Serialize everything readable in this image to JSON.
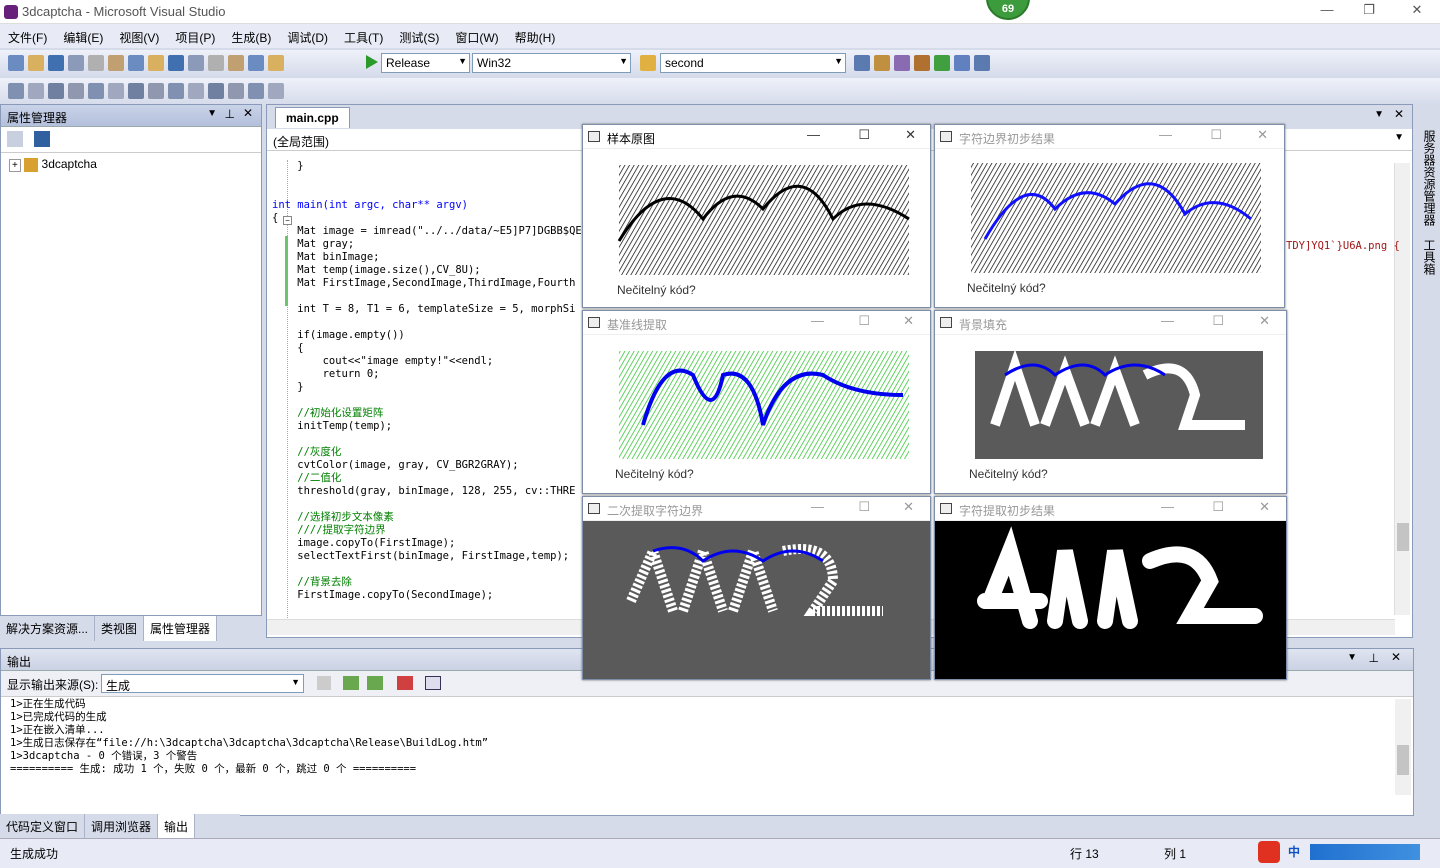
{
  "window": {
    "title": "3dcaptcha - Microsoft Visual Studio",
    "badge": "69"
  },
  "menu": [
    "文件(F)",
    "编辑(E)",
    "视图(V)",
    "项目(P)",
    "生成(B)",
    "调试(D)",
    "工具(T)",
    "测试(S)",
    "窗口(W)",
    "帮助(H)"
  ],
  "toolbar": {
    "config": "Release",
    "platform": "Win32",
    "find": "second"
  },
  "prop_manager": {
    "title": "属性管理器",
    "tree_item": "3dcaptcha"
  },
  "bottom_tabs": [
    "解决方案资源...",
    "类视图",
    "属性管理器"
  ],
  "editor": {
    "tab": "main.cpp",
    "scope": "(全局范围)",
    "right_fragment": "TDY]YQ1`}U6A.png {",
    "lines": [
      {
        "t": "    }",
        "c": ""
      },
      {
        "t": "",
        "c": ""
      },
      {
        "t": "",
        "c": ""
      },
      {
        "t": "int main(int argc, char** argv)",
        "c": "kw"
      },
      {
        "t": "{",
        "c": ""
      },
      {
        "t": "    Mat image = imread(\"../../data/~E5]P7]DGBB$QE",
        "c": ""
      },
      {
        "t": "    Mat gray;",
        "c": ""
      },
      {
        "t": "    Mat binImage;",
        "c": ""
      },
      {
        "t": "    Mat temp(image.size(),CV_8U);",
        "c": ""
      },
      {
        "t": "    Mat FirstImage,SecondImage,ThirdImage,Fourth",
        "c": ""
      },
      {
        "t": "",
        "c": ""
      },
      {
        "t": "    int T = 8, T1 = 6, templateSize = 5, morphSi",
        "c": ""
      },
      {
        "t": "",
        "c": ""
      },
      {
        "t": "    if(image.empty())",
        "c": ""
      },
      {
        "t": "    {",
        "c": ""
      },
      {
        "t": "        cout<<\"image empty!\"<<endl;",
        "c": ""
      },
      {
        "t": "        return 0;",
        "c": ""
      },
      {
        "t": "    }",
        "c": ""
      },
      {
        "t": "",
        "c": ""
      },
      {
        "t": "    //初始化设置矩阵",
        "c": "cm"
      },
      {
        "t": "    initTemp(temp);",
        "c": ""
      },
      {
        "t": "",
        "c": ""
      },
      {
        "t": "    //灰度化",
        "c": "cm"
      },
      {
        "t": "    cvtColor(image, gray, CV_BGR2GRAY);",
        "c": ""
      },
      {
        "t": "    //二值化",
        "c": "cm"
      },
      {
        "t": "    threshold(gray, binImage, 128, 255, cv::THRE",
        "c": ""
      },
      {
        "t": "",
        "c": ""
      },
      {
        "t": "    //选择初步文本像素",
        "c": "cm"
      },
      {
        "t": "    ////提取字符边界",
        "c": "cm"
      },
      {
        "t": "    image.copyTo(FirstImage);",
        "c": ""
      },
      {
        "t": "    selectTextFirst(binImage, FirstImage,temp);",
        "c": ""
      },
      {
        "t": "",
        "c": ""
      },
      {
        "t": "    //背景去除",
        "c": "cm"
      },
      {
        "t": "    FirstImage.copyTo(SecondImage);",
        "c": ""
      }
    ]
  },
  "cv_windows": [
    {
      "title": "样本原图",
      "caption": "Nečitelný kód?"
    },
    {
      "title": "字符边界初步结果",
      "caption": "Nečitelný kód?"
    },
    {
      "title": "基准线提取",
      "caption": "Nečitelný kód?"
    },
    {
      "title": "背景填充",
      "caption": "Nečitelný kód?"
    },
    {
      "title": "二次提取字符边界",
      "caption": ""
    },
    {
      "title": "字符提取初步结果",
      "caption": ""
    }
  ],
  "output": {
    "title": "输出",
    "source_label": "显示输出来源(S):",
    "source_value": "生成",
    "lines": [
      "1>正在生成代码",
      "1>已完成代码的生成",
      "1>正在嵌入清单...",
      "1>生成日志保存在“file://h:\\3dcaptcha\\3dcaptcha\\3dcaptcha\\Release\\BuildLog.htm”",
      "1>3dcaptcha - 0 个错误，3 个警告",
      "========== 生成: 成功 1 个，失败 0 个，最新 0 个，跳过 0 个 =========="
    ]
  },
  "bottom_tabs2": [
    "代码定义窗口",
    "调用浏览器",
    "输出"
  ],
  "side_tabs": [
    "服务器资源管理器",
    "工具箱"
  ],
  "status": {
    "text": "生成成功",
    "line": "行 13",
    "col": "列 1",
    "ime": "中"
  }
}
